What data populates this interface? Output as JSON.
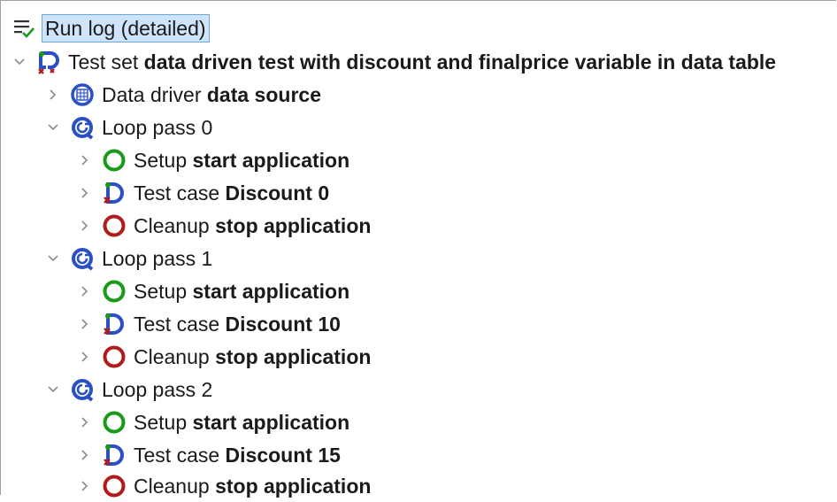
{
  "root": {
    "label": "Run log (detailed)"
  },
  "tree": [
    {
      "id": "testset",
      "prefix": "Test set",
      "name": "data driven test with discount and finalprice variable in data table",
      "icon": "test-set-icon"
    },
    {
      "id": "datadriver",
      "prefix": "Data driver",
      "name": "data source",
      "icon": "data-driver-icon"
    },
    {
      "id": "loop0",
      "prefix": "Loop pass 0",
      "name": "",
      "icon": "loop-icon"
    },
    {
      "id": "setup0",
      "prefix": "Setup",
      "name": "start application",
      "icon": "setup-icon"
    },
    {
      "id": "case0",
      "prefix": "Test case",
      "name": "Discount 0",
      "icon": "test-case-icon"
    },
    {
      "id": "cleanup0",
      "prefix": "Cleanup",
      "name": "stop application",
      "icon": "cleanup-icon"
    },
    {
      "id": "loop1",
      "prefix": "Loop pass 1",
      "name": "",
      "icon": "loop-icon"
    },
    {
      "id": "setup1",
      "prefix": "Setup",
      "name": "start application",
      "icon": "setup-icon"
    },
    {
      "id": "case1",
      "prefix": "Test case",
      "name": "Discount 10",
      "icon": "test-case-icon"
    },
    {
      "id": "cleanup1",
      "prefix": "Cleanup",
      "name": "stop application",
      "icon": "cleanup-icon"
    },
    {
      "id": "loop2",
      "prefix": "Loop pass 2",
      "name": "",
      "icon": "loop-icon"
    },
    {
      "id": "setup2",
      "prefix": "Setup",
      "name": "start application",
      "icon": "setup-icon"
    },
    {
      "id": "case2",
      "prefix": "Test case",
      "name": "Discount 15",
      "icon": "test-case-icon"
    },
    {
      "id": "cleanup2",
      "prefix": "Cleanup",
      "name": "stop application",
      "icon": "cleanup-icon"
    }
  ],
  "colors": {
    "pass": "#1a9a1a",
    "error": "#b01c1c",
    "node": "#2b4fc4"
  }
}
